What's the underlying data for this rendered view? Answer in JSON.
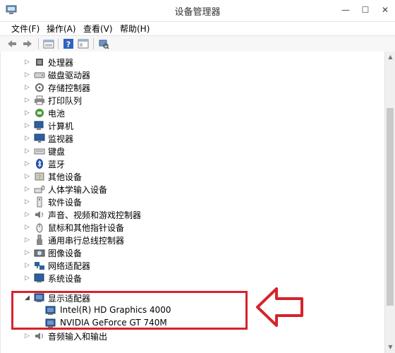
{
  "window": {
    "title": "设备管理器",
    "minimize_glyph": "—",
    "maximize_glyph": "☐",
    "close_glyph": "✕"
  },
  "menu": {
    "items": [
      "文件(F)",
      "操作(A)",
      "查看(V)",
      "帮助(H)"
    ]
  },
  "toolbar": {
    "buttons": [
      "back-icon",
      "forward-icon",
      "properties-icon",
      "help-icon",
      "view-icon",
      "scan-icon"
    ]
  },
  "tree": {
    "items": [
      {
        "label": "处理器",
        "icon": "processor-icon"
      },
      {
        "label": "磁盘驱动器",
        "icon": "disk-drive-icon"
      },
      {
        "label": "存储控制器",
        "icon": "storage-controller-icon"
      },
      {
        "label": "打印队列",
        "icon": "printer-icon"
      },
      {
        "label": "电池",
        "icon": "battery-icon"
      },
      {
        "label": "计算机",
        "icon": "computer-icon"
      },
      {
        "label": "监视器",
        "icon": "monitor-icon"
      },
      {
        "label": "键盘",
        "icon": "keyboard-icon"
      },
      {
        "label": "蓝牙",
        "icon": "bluetooth-icon"
      },
      {
        "label": "其他设备",
        "icon": "other-devices-icon"
      },
      {
        "label": "人体学输入设备",
        "icon": "hid-icon"
      },
      {
        "label": "软件设备",
        "icon": "software-device-icon"
      },
      {
        "label": "声音、视频和游戏控制器",
        "icon": "sound-icon"
      },
      {
        "label": "鼠标和其他指针设备",
        "icon": "mouse-icon"
      },
      {
        "label": "通用串行总线控制器",
        "icon": "usb-icon"
      },
      {
        "label": "图像设备",
        "icon": "imaging-icon"
      },
      {
        "label": "网络适配器",
        "icon": "network-adapter-icon"
      },
      {
        "label": "系统设备",
        "icon": "system-device-icon"
      },
      {
        "label": "显示适配器",
        "icon": "display-adapter-icon",
        "expanded": true
      },
      {
        "label": "Intel(R) HD Graphics 4000",
        "icon": "display-adapter-icon",
        "child": true
      },
      {
        "label": "NVIDIA GeForce GT 740M",
        "icon": "display-adapter-icon",
        "child": true
      },
      {
        "label": "音频输入和输出",
        "icon": "audio-io-icon"
      }
    ]
  },
  "colors": {
    "highlight": "#d6232b",
    "accent": "#1f5fbf"
  }
}
